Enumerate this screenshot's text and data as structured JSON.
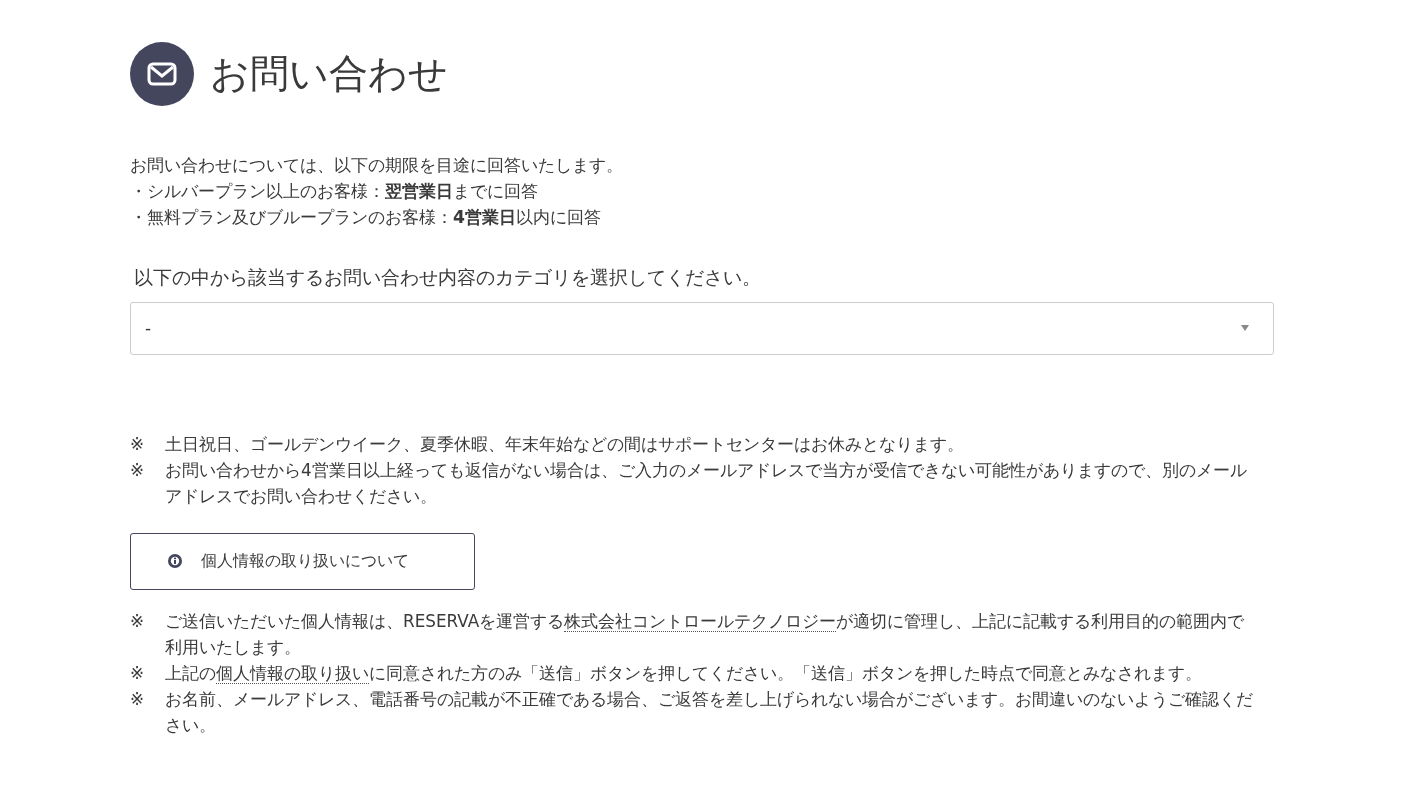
{
  "header": {
    "title": "お問い合わせ"
  },
  "intro": [
    "お問い合わせについては、以下の期限を目途に回答いたします。",
    "・シルバープラン以上のお客様：**翌営業日**までに回答",
    "・無料プラン及びブループランのお客様：**4営業日**以内に回答"
  ],
  "category": {
    "label": "以下の中から該当するお問い合わせ内容のカテゴリを選択してください。",
    "value": "-"
  },
  "notes": [
    {
      "mark": "※",
      "text": "土日祝日、ゴールデンウイーク、夏季休暇、年末年始などの間はサポートセンターはお休みとなります。"
    },
    {
      "mark": "※",
      "text": "お問い合わせから4営業日以上経っても返信がない場合は、ご入力のメールアドレスで当方が受信できない可能性がありますので、別のメールアドレスでお問い合わせください。"
    }
  ],
  "privacy_button": {
    "label": "個人情報の取り扱いについて"
  },
  "privacy_notes": [
    {
      "mark": "※",
      "parts": [
        {
          "text": "ご送信いただいた個人情報は、RESERVAを運営する",
          "kind": "text"
        },
        {
          "text": "株式会社コントロールテクノロジー",
          "kind": "link"
        },
        {
          "text": "が適切に管理し、上記に記載する利用目的の範囲内で利用いたします。",
          "kind": "text"
        }
      ]
    },
    {
      "mark": "※",
      "parts": [
        {
          "text": "上記の",
          "kind": "text"
        },
        {
          "text": "個人情報の取り扱い",
          "kind": "link"
        },
        {
          "text": "に同意された方のみ「送信」ボタンを押してください。「送信」ボタンを押した時点で同意とみなされます。",
          "kind": "text"
        }
      ]
    },
    {
      "mark": "※",
      "text": "お名前、メールアドレス、電話番号の記載が不正確である場合、ご返答を差し上げられない場合がございます。お間違いのないようご確認ください。"
    }
  ]
}
